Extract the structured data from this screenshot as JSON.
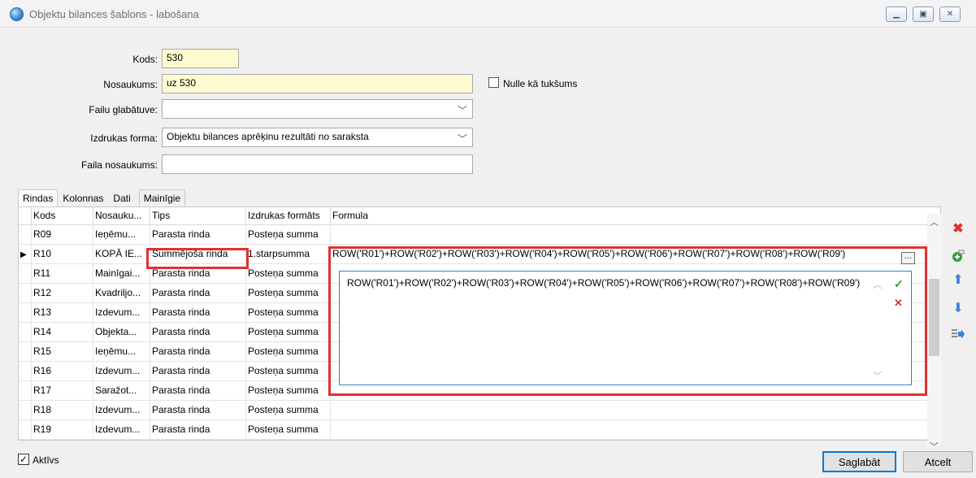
{
  "window": {
    "title": "Objektu bilances šablons - labošana",
    "minimize_icon": "minimize-icon",
    "maximize_icon": "maximize-icon",
    "close_icon": "close-icon"
  },
  "form": {
    "kods_label": "Kods:",
    "kods_value": "530",
    "nosaukums_label": "Nosaukums:",
    "nosaukums_value": "uz 530",
    "nulle_label": "Nulle kā tukšums",
    "failu_label": "Failu glabātuve:",
    "failu_value": "",
    "izdrukas_label": "Izdrukas forma:",
    "izdrukas_value": "Objektu bilances aprēķinu rezultāti no saraksta",
    "faila_nos_label": "Faila nosaukums:",
    "faila_nos_value": ""
  },
  "tabs": [
    "Rindas",
    "Kolonnas",
    "Dati",
    "Mainīgie"
  ],
  "grid": {
    "columns": [
      "Kods",
      "Nosauku...",
      "Tips",
      "Izdrukas formāts",
      "Formula"
    ],
    "rows": [
      {
        "kods": "R09",
        "nos": "Ieņēmu...",
        "tips": "Parasta rinda",
        "fmt": "Posteņa summa",
        "formula": ""
      },
      {
        "kods": "R10",
        "nos": "KOPĀ IE...",
        "tips": "Summējoša rinda",
        "fmt": "1.starpsumma",
        "formula": "ROW('R01')+ROW('R02')+ROW('R03')+ROW('R04')+ROW('R05')+ROW('R06')+ROW('R07')+ROW('R08')+ROW('R09')"
      },
      {
        "kods": "R11",
        "nos": "Mainīgai...",
        "tips": "Parasta rinda",
        "fmt": "Posteņa summa",
        "formula": ""
      },
      {
        "kods": "R12",
        "nos": "Kvadriljo...",
        "tips": "Parasta rinda",
        "fmt": "Posteņa summa",
        "formula": ""
      },
      {
        "kods": "R13",
        "nos": "Izdevum...",
        "tips": "Parasta rinda",
        "fmt": "Posteņa summa",
        "formula": ""
      },
      {
        "kods": "R14",
        "nos": "Objekta...",
        "tips": "Parasta rinda",
        "fmt": "Posteņa summa",
        "formula": ""
      },
      {
        "kods": "R15",
        "nos": "Ieņēmu...",
        "tips": "Parasta rinda",
        "fmt": "Posteņa summa",
        "formula": ""
      },
      {
        "kods": "R16",
        "nos": "Izdevum...",
        "tips": "Parasta rinda",
        "fmt": "Posteņa summa",
        "formula": ""
      },
      {
        "kods": "R17",
        "nos": "Saražot...",
        "tips": "Parasta rinda",
        "fmt": "Posteņa summa",
        "formula": ""
      },
      {
        "kods": "R18",
        "nos": "Izdevum...",
        "tips": "Parasta rinda",
        "fmt": "Posteņa summa",
        "formula": ""
      },
      {
        "kods": "R19",
        "nos": "Izdevum...",
        "tips": "Parasta rinda",
        "fmt": "Posteņa summa",
        "formula": ""
      }
    ]
  },
  "editor": {
    "text": "ROW('R01')+ROW('R02')+ROW('R03')+ROW('R04')+ROW('R05')+ROW('R06')+ROW('R07')+ROW('R08')+ROW('R09')",
    "ellipsis": "···",
    "confirm_icon": "✓",
    "cancel_icon": "✕"
  },
  "footer": {
    "aktivs_label": "Aktīvs",
    "save_label": "Saglabāt",
    "cancel_label": "Atcelt"
  },
  "colors": {
    "highlight_red": "#e03131",
    "input_yellow": "#fffbd0",
    "delete_red": "#e03131",
    "add_green": "#2e9e3a",
    "arrow_blue": "#3b82d6"
  }
}
